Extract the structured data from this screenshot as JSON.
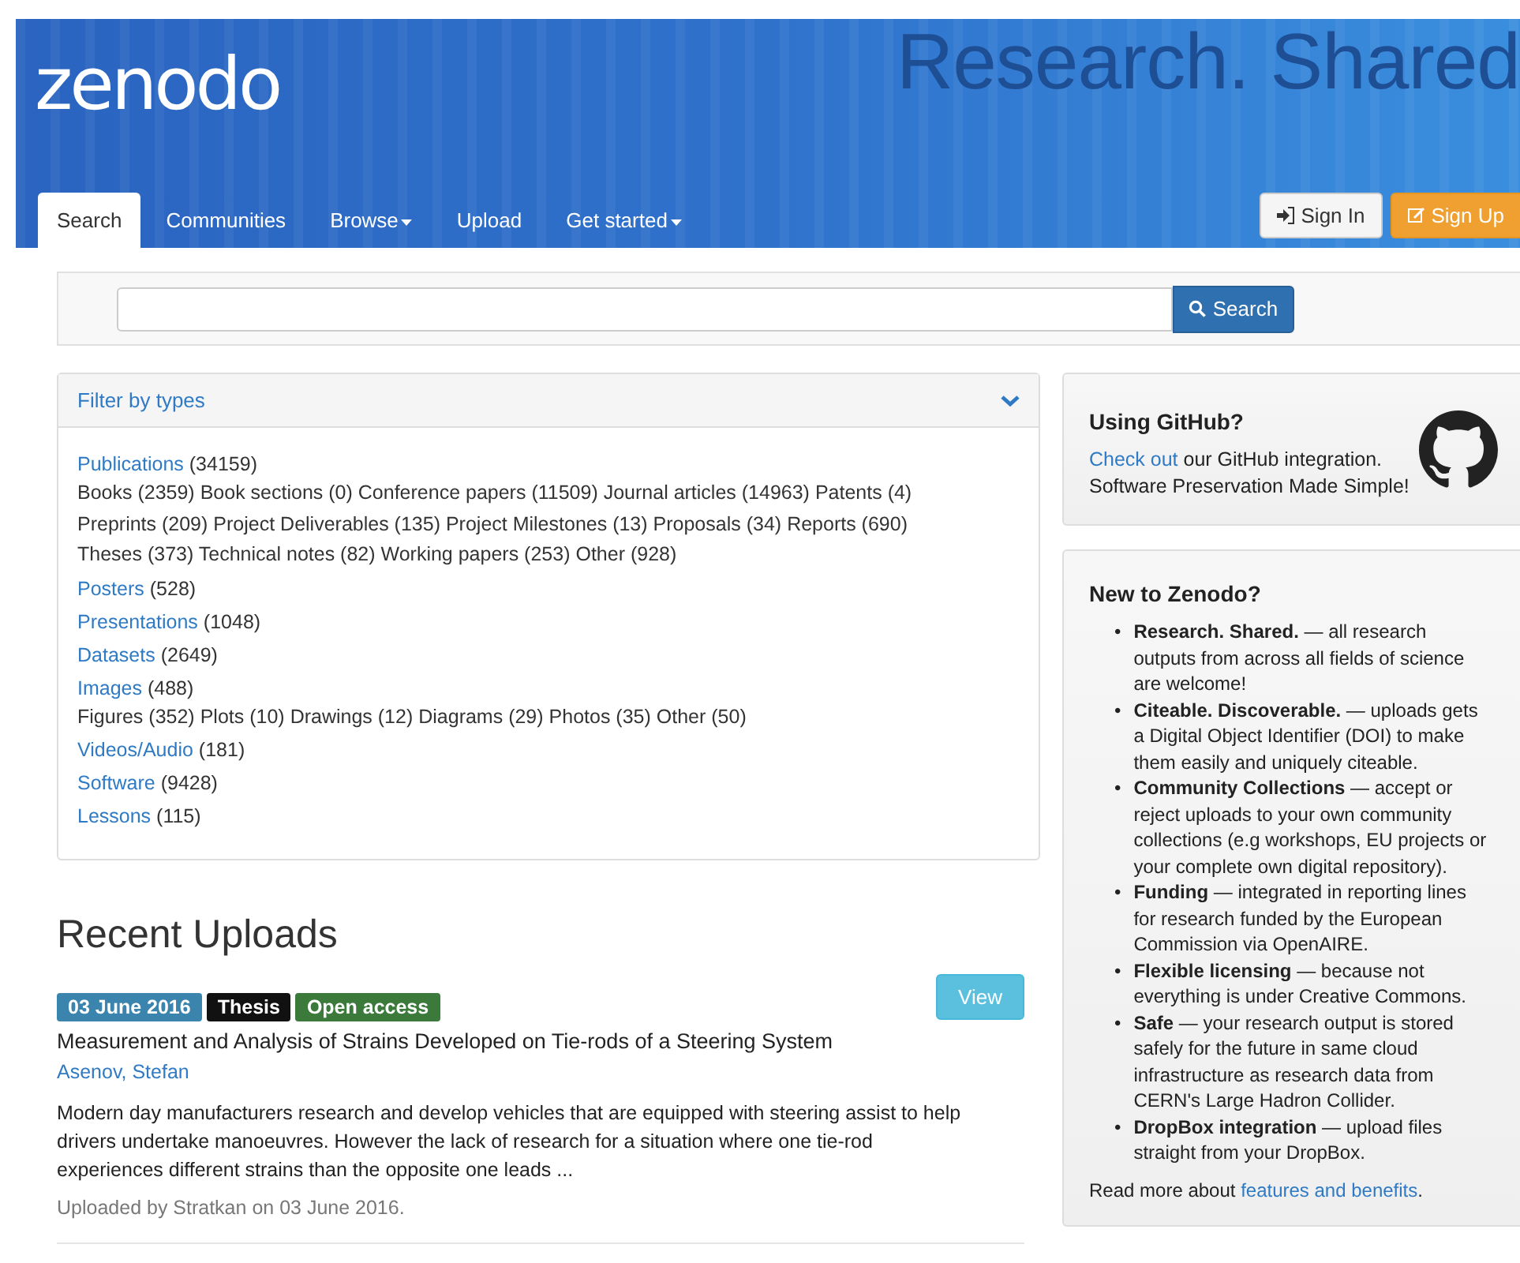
{
  "header": {
    "logo": "zenodo",
    "tagline": "Research. Shared"
  },
  "nav": {
    "tabs": [
      {
        "label": "Search",
        "selected": true,
        "dropdown": false
      },
      {
        "label": "Communities",
        "selected": false,
        "dropdown": false
      },
      {
        "label": "Browse",
        "selected": false,
        "dropdown": true
      },
      {
        "label": "Upload",
        "selected": false,
        "dropdown": false
      },
      {
        "label": "Get started",
        "selected": false,
        "dropdown": true
      }
    ],
    "buttons": [
      {
        "kind": "signin",
        "label": "Sign In"
      },
      {
        "kind": "signup",
        "label": "Sign Up"
      }
    ]
  },
  "search": {
    "button": "Search"
  },
  "filter": {
    "title": "Filter by types",
    "expanded": true,
    "groups": [
      {
        "label": "Publications",
        "count": "(34159)",
        "subtypes": [
          "Books (2359)",
          "Book sections (0)",
          "Conference papers (11509)",
          "Journal articles (14963)",
          "Patents (4)",
          "Preprints (209)",
          "Project Deliverables (135)",
          "Project Milestones (13)",
          "Proposals (34)",
          "Reports (690)",
          "Theses (373)",
          "Technical notes (82)",
          "Working papers (253)",
          "Other (928)"
        ]
      },
      {
        "label": "Posters",
        "count": "(528)"
      },
      {
        "label": "Presentations",
        "count": "(1048)"
      },
      {
        "label": "Datasets",
        "count": "(2649)"
      },
      {
        "label": "Images",
        "count": "(488)",
        "subtypes": [
          "Figures (352)",
          "Plots (10)",
          "Drawings (12)",
          "Diagrams (29)",
          "Photos (35)",
          "Other (50)"
        ]
      },
      {
        "label": "Videos/Audio",
        "count": "(181)"
      },
      {
        "label": "Software",
        "count": "(9428)"
      },
      {
        "label": "Lessons",
        "count": "(115)"
      }
    ]
  },
  "recent": {
    "title": "Recent Uploads",
    "items": [
      {
        "badges": [
          {
            "kind": "date",
            "label": "03 June 2016"
          },
          {
            "kind": "type",
            "label": "Thesis"
          },
          {
            "kind": "access",
            "label": "Open access"
          }
        ],
        "view": "View",
        "title": "Measurement and Analysis of Strains Developed on Tie-rods of a Steering System",
        "authors": "Asenov, Stefan",
        "description": "Modern day manufacturers research and develop vehicles that are equipped with steering assist to help drivers undertake manoeuvres. However the lack of research for a situation where one tie-rod experiences different strains than the opposite one leads ...",
        "uploaded": "Uploaded by Stratkan on 03 June 2016."
      }
    ]
  },
  "github": {
    "title": "Using GitHub?",
    "link": "Check out",
    "text": " our GitHub integration.",
    "line2": "Software Preservation Made Simple!"
  },
  "about": {
    "title": "New to Zenodo?",
    "marker": "•",
    "items": [
      "**Research. Shared.** — all research outputs from across all fields of science are welcome!",
      "**Citeable. Discoverable.** — uploads gets a Digital Object Identifier (DOI) to make them easily and uniquely citeable.",
      "**Community Collections** — accept or reject uploads to your own community collections (e.g workshops, EU projects or your complete own digital repository).",
      "**Funding** — integrated in reporting lines for research funded by the European Commission via OpenAIRE.",
      "**Flexible licensing** — because not everything is under Creative Commons.",
      "**Safe** — your research output is stored safely for the future in same cloud infrastructure as research data from CERN's Large Hadron Collider.",
      "**DropBox integration** — upload files straight from your DropBox."
    ],
    "more": "Read more about ",
    "more_link": "features and benefits",
    "more_end": "."
  }
}
